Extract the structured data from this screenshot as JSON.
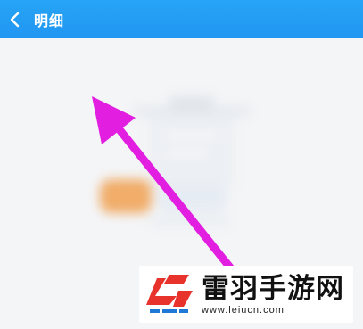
{
  "header": {
    "title": "明细",
    "back_icon": "chevron-left-icon",
    "background": "#2196f3"
  },
  "content": {
    "state": "empty",
    "illustration_icon": "empty-clipboard-icon",
    "blurred": true
  },
  "annotation": {
    "type": "arrow",
    "color": "#e21ee0",
    "points_to": "back-button"
  },
  "watermark": {
    "name": "雷羽手游网",
    "url": "www.leiucn.com",
    "brand_color": "#e8322c",
    "accent_color": "#1e78d6"
  }
}
